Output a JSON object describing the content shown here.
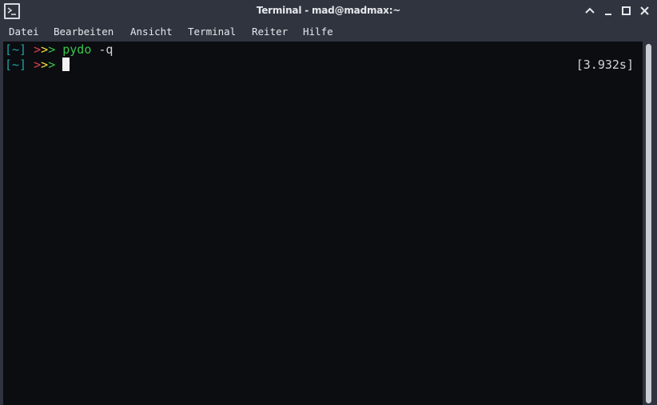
{
  "window": {
    "title": "Terminal - mad@madmax:~",
    "app_icon": "terminal-icon",
    "controls": [
      "chevron-up-icon",
      "minimize-icon",
      "maximize-icon",
      "close-icon"
    ]
  },
  "menu": {
    "items": [
      "Datei",
      "Bearbeiten",
      "Ansicht",
      "Terminal",
      "Reiter",
      "Hilfe"
    ]
  },
  "terminal": {
    "lines": [
      {
        "dir": "[~]",
        "prompt": [
          ">",
          ">",
          ">"
        ],
        "command": "pydo",
        "args": "-q"
      },
      {
        "dir": "[~]",
        "prompt": [
          ">",
          ">",
          ">"
        ],
        "command": "",
        "args": ""
      }
    ],
    "timing": "[3.932s]"
  },
  "colors": {
    "background": "#0b0d11",
    "dir": "#1fa3a8",
    "arrow_red": "#e0414b",
    "arrow_yellow": "#f0e040",
    "arrow_green": "#37c54a",
    "command": "#37c54a"
  }
}
